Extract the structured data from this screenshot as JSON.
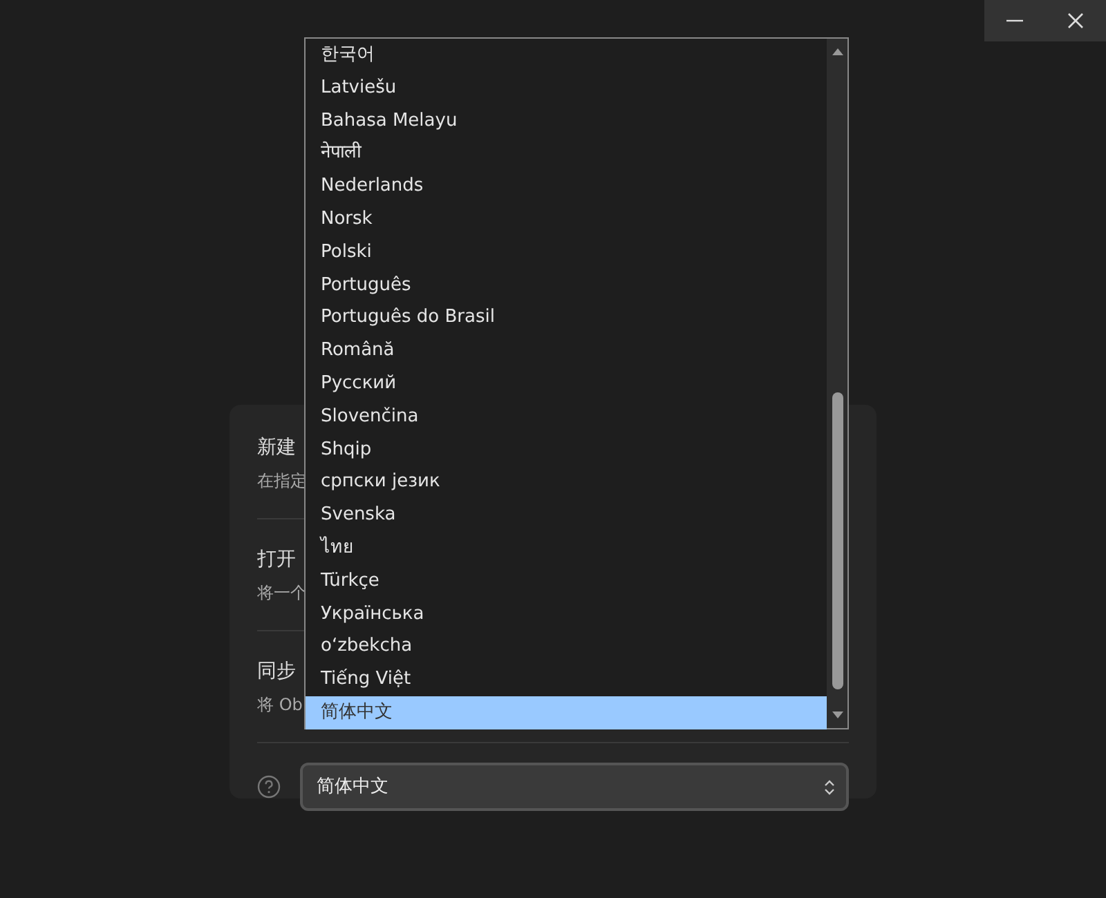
{
  "card": {
    "rows": [
      {
        "title": "新建",
        "description": "在指定"
      },
      {
        "title": "打开",
        "description": "将一个"
      },
      {
        "title": "同步",
        "description": "将 Ob"
      }
    ]
  },
  "language_select": {
    "value": "简体中文"
  },
  "dropdown": {
    "options": [
      {
        "label": "한국어",
        "selected": false
      },
      {
        "label": "Latviešu",
        "selected": false
      },
      {
        "label": "Bahasa Melayu",
        "selected": false
      },
      {
        "label": "नेपाली",
        "selected": false
      },
      {
        "label": "Nederlands",
        "selected": false
      },
      {
        "label": "Norsk",
        "selected": false
      },
      {
        "label": "Polski",
        "selected": false
      },
      {
        "label": "Português",
        "selected": false
      },
      {
        "label": "Português do Brasil",
        "selected": false
      },
      {
        "label": "Română",
        "selected": false
      },
      {
        "label": "Русский",
        "selected": false
      },
      {
        "label": "Slovenčina",
        "selected": false
      },
      {
        "label": "Shqip",
        "selected": false
      },
      {
        "label": "српски језик",
        "selected": false
      },
      {
        "label": "Svenska",
        "selected": false
      },
      {
        "label": "ไทย",
        "selected": false
      },
      {
        "label": "Türkçe",
        "selected": false
      },
      {
        "label": "Українська",
        "selected": false
      },
      {
        "label": "o‘zbekcha",
        "selected": false
      },
      {
        "label": "Tiếng Việt",
        "selected": false
      },
      {
        "label": "简体中文",
        "selected": true
      }
    ]
  }
}
